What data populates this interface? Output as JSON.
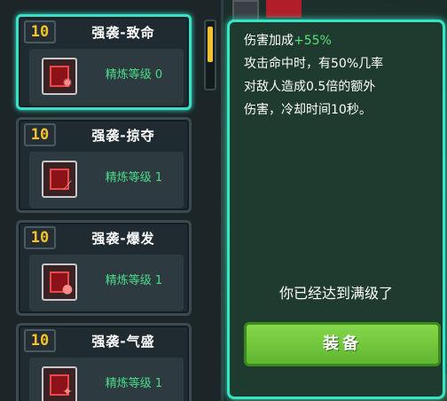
{
  "skills": [
    {
      "level": "10",
      "title": "强袭-致命",
      "refine_label": "精炼等级 0",
      "icon": "crosshair-skull-icon"
    },
    {
      "level": "10",
      "title": "强袭-掠夺",
      "refine_label": "精炼等级 1",
      "icon": "claw-slash-icon"
    },
    {
      "level": "10",
      "title": "强袭-爆发",
      "refine_label": "精炼等级 1",
      "icon": "fire-burst-icon"
    },
    {
      "level": "10",
      "title": "强袭-气盛",
      "refine_label": "精炼等级 1",
      "icon": "aura-icon"
    }
  ],
  "tooltip": {
    "bonus_label": "伤害加成",
    "bonus_value": "+55%",
    "description_1": "攻击命中时，有50%几率",
    "description_2": "对敌人造成0.5倍的额外",
    "description_3": "伤害，冷却时间10秒。",
    "max_level_text": "你已经达到满级了",
    "equip_label": "装备"
  },
  "colors": {
    "selected_border": "#38e0c8",
    "level_badge": "#f6c22b",
    "refine_text": "#4bdb8a",
    "bonus_value": "#56e07a",
    "equip_button": "#7ccc3f"
  }
}
